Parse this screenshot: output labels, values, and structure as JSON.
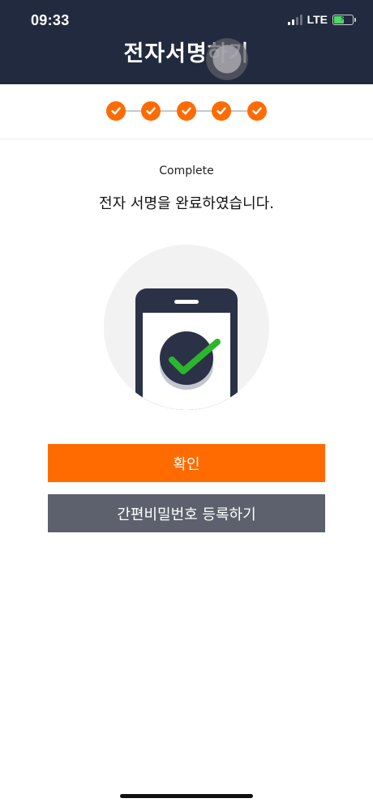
{
  "status_bar": {
    "time": "09:33",
    "network": "LTE"
  },
  "header": {
    "title": "전자서명하기"
  },
  "steps": [
    {
      "state": "done"
    },
    {
      "state": "done"
    },
    {
      "state": "done"
    },
    {
      "state": "done"
    },
    {
      "state": "done"
    }
  ],
  "content": {
    "label": "Complete",
    "message": "전자 서명을 완료하였습니다."
  },
  "buttons": {
    "confirm_label": "확인",
    "register_label": "간편비밀번호 등록하기"
  },
  "colors": {
    "header_bg": "#222a3f",
    "accent": "#ff6b00",
    "secondary_button": "#5d616e",
    "check_green": "#2db52d"
  },
  "icons": {
    "step": "check-icon",
    "illustration": "phone-checkmark-icon"
  }
}
